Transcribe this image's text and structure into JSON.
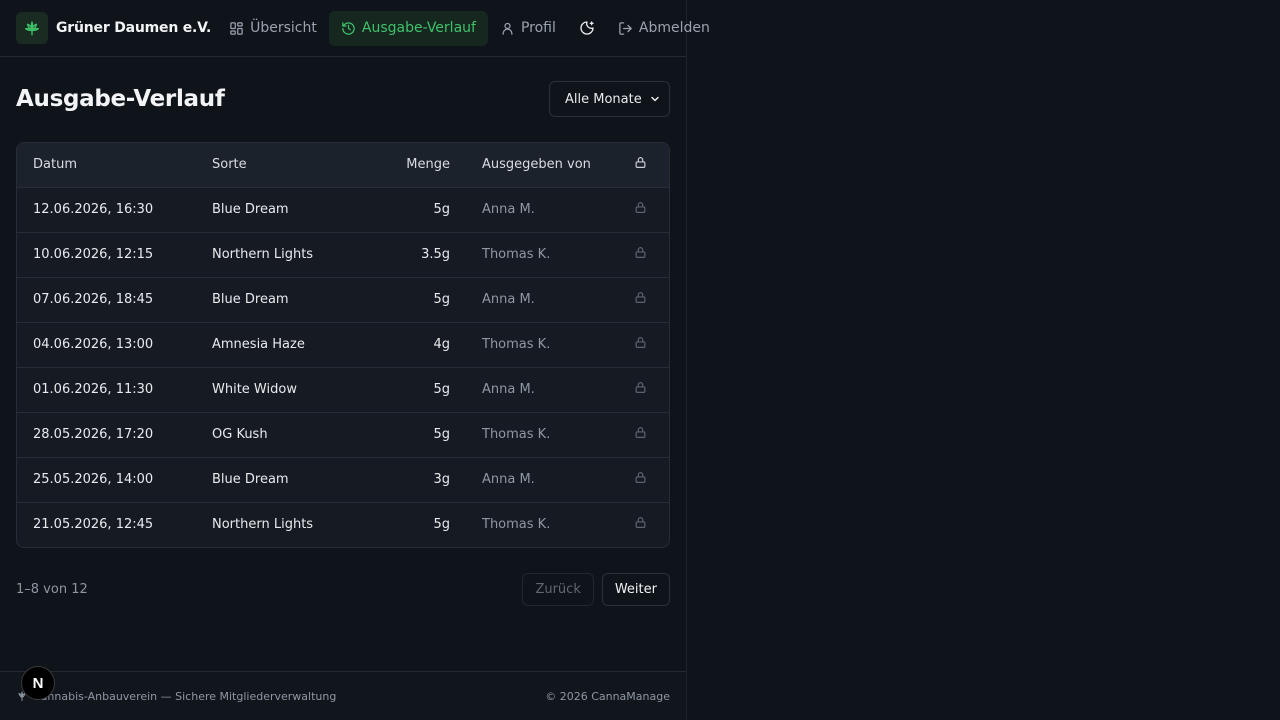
{
  "brand": {
    "name": "Grüner Daumen e.V."
  },
  "nav": {
    "overview": "Übersicht",
    "history": "Ausgabe-Verlauf",
    "profile": "Profil",
    "logout": "Abmelden"
  },
  "page": {
    "title": "Ausgabe-Verlauf",
    "month_filter": "Alle Monate"
  },
  "table": {
    "headers": {
      "date": "Datum",
      "strain": "Sorte",
      "qty": "Menge",
      "by": "Ausgegeben von"
    },
    "rows": [
      {
        "date": "12.06.2026, 16:30",
        "strain": "Blue Dream",
        "qty": "5g",
        "by": "Anna M."
      },
      {
        "date": "10.06.2026, 12:15",
        "strain": "Northern Lights",
        "qty": "3.5g",
        "by": "Thomas K."
      },
      {
        "date": "07.06.2026, 18:45",
        "strain": "Blue Dream",
        "qty": "5g",
        "by": "Anna M."
      },
      {
        "date": "04.06.2026, 13:00",
        "strain": "Amnesia Haze",
        "qty": "4g",
        "by": "Thomas K."
      },
      {
        "date": "01.06.2026, 11:30",
        "strain": "White Widow",
        "qty": "5g",
        "by": "Anna M."
      },
      {
        "date": "28.05.2026, 17:20",
        "strain": "OG Kush",
        "qty": "5g",
        "by": "Thomas K."
      },
      {
        "date": "25.05.2026, 14:00",
        "strain": "Blue Dream",
        "qty": "3g",
        "by": "Anna M."
      },
      {
        "date": "21.05.2026, 12:45",
        "strain": "Northern Lights",
        "qty": "5g",
        "by": "Thomas K."
      }
    ]
  },
  "pagination": {
    "count": "1–8 von 12",
    "prev": "Zurück",
    "next": "Weiter"
  },
  "footer": {
    "left": "Cannabis-Anbauverein — Sichere Mitgliederverwaltung",
    "right": "© 2026 CannaManage"
  },
  "dev_badge": "N",
  "colors": {
    "accent": "#3fc16a",
    "background": "#0f131a",
    "card": "#161b23"
  }
}
